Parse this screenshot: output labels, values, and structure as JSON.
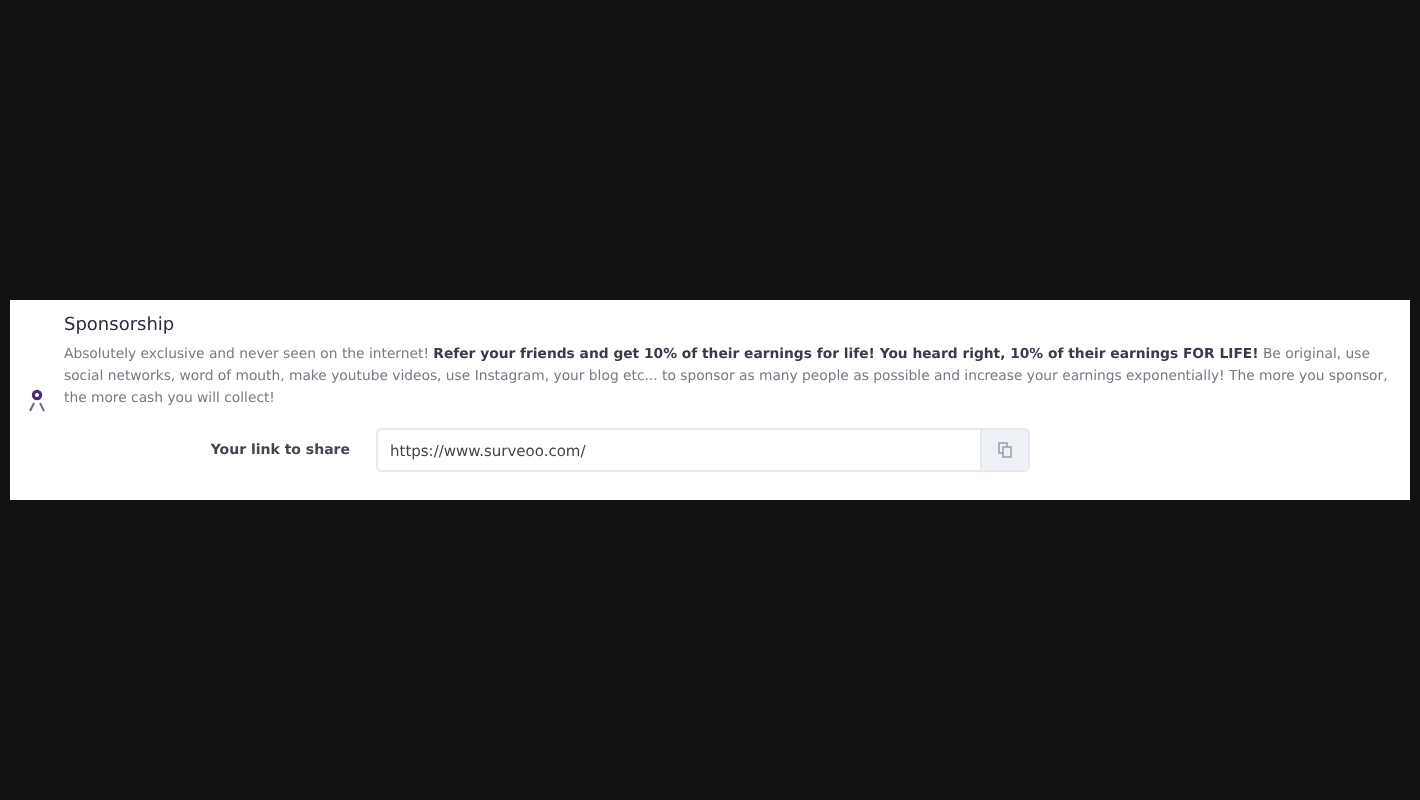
{
  "section": {
    "title": "Sponsorship",
    "description": "Absolutely exclusive and never seen on the internet! **Refer your friends and get 10% of their earnings for life! You heard right, 10% of their earnings FOR LIFE!** Be original, use social networks, word of mouth, make youtube videos, use Instagram, your blog etc... to sponsor as many people as possible and increase your earnings exponentially! The more you sponsor, the more cash you will collect!",
    "link_field": {
      "label": "Your link to share",
      "value": "https://www.surveoo.com/"
    }
  }
}
